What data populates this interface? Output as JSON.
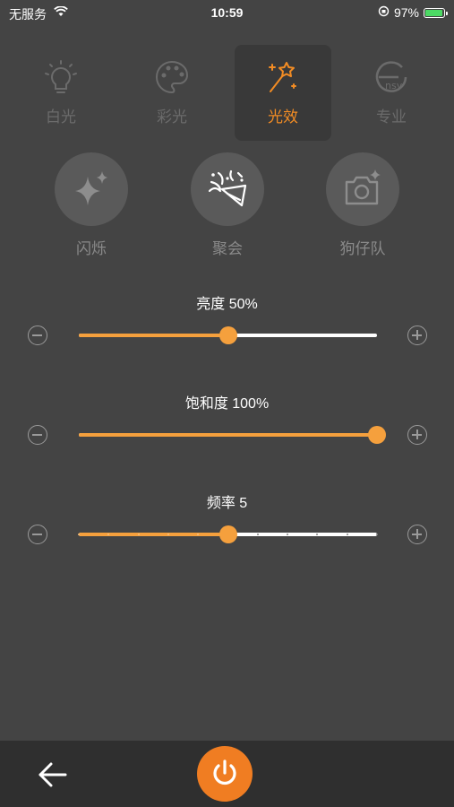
{
  "status_bar": {
    "carrier": "无服务",
    "time": "10:59",
    "battery": "97%"
  },
  "mode_tabs": [
    {
      "label": "白光",
      "icon": "bulb-icon",
      "active": false
    },
    {
      "label": "彩光",
      "icon": "palette-icon",
      "active": false
    },
    {
      "label": "光效",
      "icon": "magic-wand-icon",
      "active": true
    },
    {
      "label": "专业",
      "icon": "ensy-logo-icon",
      "active": false
    }
  ],
  "effects": [
    {
      "label": "闪烁",
      "icon": "sparkle-icon",
      "active": false
    },
    {
      "label": "聚会",
      "icon": "party-popper-icon",
      "active": true
    },
    {
      "label": "狗仔队",
      "icon": "camera-icon",
      "active": false
    }
  ],
  "sliders": {
    "brightness": {
      "title": "亮度 50%",
      "value": 0.5
    },
    "saturation": {
      "title": "饱和度 100%",
      "value": 1.0
    },
    "frequency": {
      "title": "频率 5",
      "value": 5,
      "max": 10
    }
  },
  "colors": {
    "accent": "#f07d22",
    "slider_fill": "#f5a03d",
    "background": "#444444",
    "inactive": "#6b6b6b"
  },
  "bottom_bar": {
    "back": "back-arrow-icon",
    "power": "power-icon"
  }
}
